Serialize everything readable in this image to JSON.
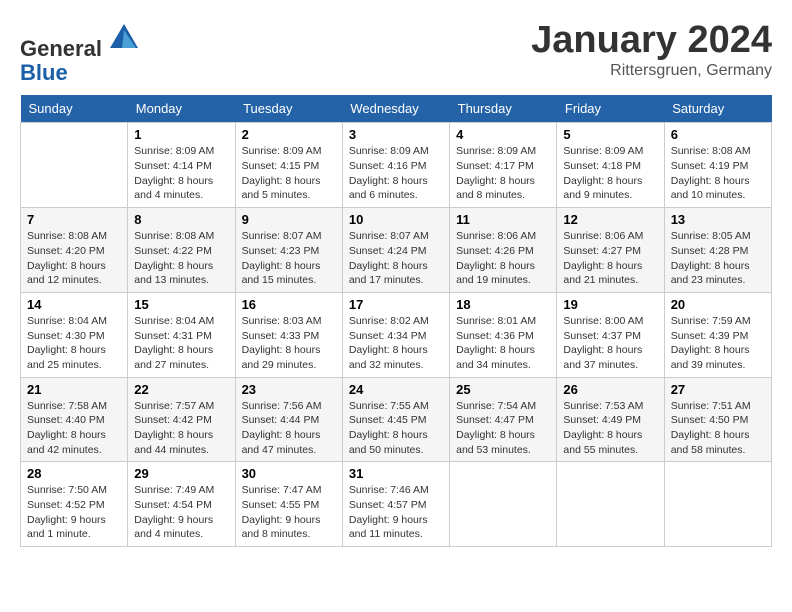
{
  "header": {
    "logo_line1": "General",
    "logo_line2": "Blue",
    "month_title": "January 2024",
    "subtitle": "Rittersgruen, Germany"
  },
  "days_of_week": [
    "Sunday",
    "Monday",
    "Tuesday",
    "Wednesday",
    "Thursday",
    "Friday",
    "Saturday"
  ],
  "weeks": [
    [
      {
        "day": "",
        "sunrise": "",
        "sunset": "",
        "daylight": "",
        "empty": true
      },
      {
        "day": "1",
        "sunrise": "Sunrise: 8:09 AM",
        "sunset": "Sunset: 4:14 PM",
        "daylight": "Daylight: 8 hours and 4 minutes."
      },
      {
        "day": "2",
        "sunrise": "Sunrise: 8:09 AM",
        "sunset": "Sunset: 4:15 PM",
        "daylight": "Daylight: 8 hours and 5 minutes."
      },
      {
        "day": "3",
        "sunrise": "Sunrise: 8:09 AM",
        "sunset": "Sunset: 4:16 PM",
        "daylight": "Daylight: 8 hours and 6 minutes."
      },
      {
        "day": "4",
        "sunrise": "Sunrise: 8:09 AM",
        "sunset": "Sunset: 4:17 PM",
        "daylight": "Daylight: 8 hours and 8 minutes."
      },
      {
        "day": "5",
        "sunrise": "Sunrise: 8:09 AM",
        "sunset": "Sunset: 4:18 PM",
        "daylight": "Daylight: 8 hours and 9 minutes."
      },
      {
        "day": "6",
        "sunrise": "Sunrise: 8:08 AM",
        "sunset": "Sunset: 4:19 PM",
        "daylight": "Daylight: 8 hours and 10 minutes."
      }
    ],
    [
      {
        "day": "7",
        "sunrise": "Sunrise: 8:08 AM",
        "sunset": "Sunset: 4:20 PM",
        "daylight": "Daylight: 8 hours and 12 minutes."
      },
      {
        "day": "8",
        "sunrise": "Sunrise: 8:08 AM",
        "sunset": "Sunset: 4:22 PM",
        "daylight": "Daylight: 8 hours and 13 minutes."
      },
      {
        "day": "9",
        "sunrise": "Sunrise: 8:07 AM",
        "sunset": "Sunset: 4:23 PM",
        "daylight": "Daylight: 8 hours and 15 minutes."
      },
      {
        "day": "10",
        "sunrise": "Sunrise: 8:07 AM",
        "sunset": "Sunset: 4:24 PM",
        "daylight": "Daylight: 8 hours and 17 minutes."
      },
      {
        "day": "11",
        "sunrise": "Sunrise: 8:06 AM",
        "sunset": "Sunset: 4:26 PM",
        "daylight": "Daylight: 8 hours and 19 minutes."
      },
      {
        "day": "12",
        "sunrise": "Sunrise: 8:06 AM",
        "sunset": "Sunset: 4:27 PM",
        "daylight": "Daylight: 8 hours and 21 minutes."
      },
      {
        "day": "13",
        "sunrise": "Sunrise: 8:05 AM",
        "sunset": "Sunset: 4:28 PM",
        "daylight": "Daylight: 8 hours and 23 minutes."
      }
    ],
    [
      {
        "day": "14",
        "sunrise": "Sunrise: 8:04 AM",
        "sunset": "Sunset: 4:30 PM",
        "daylight": "Daylight: 8 hours and 25 minutes."
      },
      {
        "day": "15",
        "sunrise": "Sunrise: 8:04 AM",
        "sunset": "Sunset: 4:31 PM",
        "daylight": "Daylight: 8 hours and 27 minutes."
      },
      {
        "day": "16",
        "sunrise": "Sunrise: 8:03 AM",
        "sunset": "Sunset: 4:33 PM",
        "daylight": "Daylight: 8 hours and 29 minutes."
      },
      {
        "day": "17",
        "sunrise": "Sunrise: 8:02 AM",
        "sunset": "Sunset: 4:34 PM",
        "daylight": "Daylight: 8 hours and 32 minutes."
      },
      {
        "day": "18",
        "sunrise": "Sunrise: 8:01 AM",
        "sunset": "Sunset: 4:36 PM",
        "daylight": "Daylight: 8 hours and 34 minutes."
      },
      {
        "day": "19",
        "sunrise": "Sunrise: 8:00 AM",
        "sunset": "Sunset: 4:37 PM",
        "daylight": "Daylight: 8 hours and 37 minutes."
      },
      {
        "day": "20",
        "sunrise": "Sunrise: 7:59 AM",
        "sunset": "Sunset: 4:39 PM",
        "daylight": "Daylight: 8 hours and 39 minutes."
      }
    ],
    [
      {
        "day": "21",
        "sunrise": "Sunrise: 7:58 AM",
        "sunset": "Sunset: 4:40 PM",
        "daylight": "Daylight: 8 hours and 42 minutes."
      },
      {
        "day": "22",
        "sunrise": "Sunrise: 7:57 AM",
        "sunset": "Sunset: 4:42 PM",
        "daylight": "Daylight: 8 hours and 44 minutes."
      },
      {
        "day": "23",
        "sunrise": "Sunrise: 7:56 AM",
        "sunset": "Sunset: 4:44 PM",
        "daylight": "Daylight: 8 hours and 47 minutes."
      },
      {
        "day": "24",
        "sunrise": "Sunrise: 7:55 AM",
        "sunset": "Sunset: 4:45 PM",
        "daylight": "Daylight: 8 hours and 50 minutes."
      },
      {
        "day": "25",
        "sunrise": "Sunrise: 7:54 AM",
        "sunset": "Sunset: 4:47 PM",
        "daylight": "Daylight: 8 hours and 53 minutes."
      },
      {
        "day": "26",
        "sunrise": "Sunrise: 7:53 AM",
        "sunset": "Sunset: 4:49 PM",
        "daylight": "Daylight: 8 hours and 55 minutes."
      },
      {
        "day": "27",
        "sunrise": "Sunrise: 7:51 AM",
        "sunset": "Sunset: 4:50 PM",
        "daylight": "Daylight: 8 hours and 58 minutes."
      }
    ],
    [
      {
        "day": "28",
        "sunrise": "Sunrise: 7:50 AM",
        "sunset": "Sunset: 4:52 PM",
        "daylight": "Daylight: 9 hours and 1 minute."
      },
      {
        "day": "29",
        "sunrise": "Sunrise: 7:49 AM",
        "sunset": "Sunset: 4:54 PM",
        "daylight": "Daylight: 9 hours and 4 minutes."
      },
      {
        "day": "30",
        "sunrise": "Sunrise: 7:47 AM",
        "sunset": "Sunset: 4:55 PM",
        "daylight": "Daylight: 9 hours and 8 minutes."
      },
      {
        "day": "31",
        "sunrise": "Sunrise: 7:46 AM",
        "sunset": "Sunset: 4:57 PM",
        "daylight": "Daylight: 9 hours and 11 minutes."
      },
      {
        "day": "",
        "sunrise": "",
        "sunset": "",
        "daylight": "",
        "empty": true
      },
      {
        "day": "",
        "sunrise": "",
        "sunset": "",
        "daylight": "",
        "empty": true
      },
      {
        "day": "",
        "sunrise": "",
        "sunset": "",
        "daylight": "",
        "empty": true
      }
    ]
  ]
}
